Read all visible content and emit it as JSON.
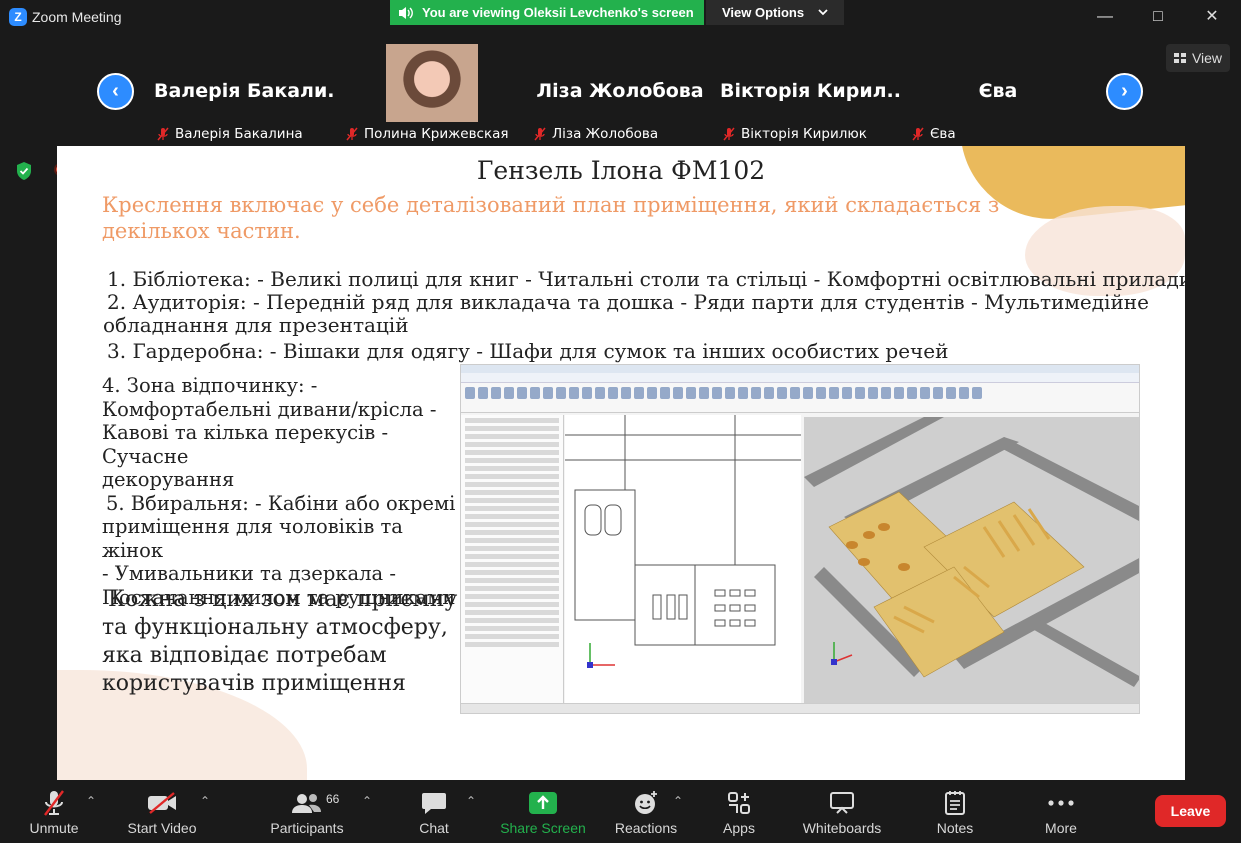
{
  "window": {
    "title": "Zoom Meeting",
    "viewing_banner": "You are viewing Oleksii Levchenko's screen",
    "view_options_label": "View Options",
    "view_label": "View"
  },
  "gallery": {
    "tiles": [
      {
        "big_name": "Валерія Бакали...",
        "sub_name": "Валерія Бакалина"
      },
      {
        "big_name": "",
        "sub_name": "Полина Крижевская"
      },
      {
        "big_name": "Ліза Жолобова",
        "sub_name": "Ліза Жолобова"
      },
      {
        "big_name": "Вікторія Кирил...",
        "sub_name": "Вікторія Кирилюк"
      },
      {
        "big_name": "Єва",
        "sub_name": "Єва"
      }
    ]
  },
  "slide": {
    "title": "Гензель Ілона ФМ102",
    "subtitle": "Креслення включає у себе деталізований план приміщення, який складається з декількох частин.",
    "items": [
      "1. Бібліотека: - Великі полиці для книг - Читальні столи та стільці - Комфортні освітлювальні прилади",
      "2. Аудиторія: - Передній ряд для викладача та дошка - Ряди парти для студентів - Мультимедійне",
      "обладнання для презентацій",
      "3. Гардеробна: - Вішаки для одягу - Шафи для сумок та інших особистих речей"
    ],
    "left_col": [
      "4. Зона відпочинку: -",
      "Комфортабельні дивани/крісла -",
      "Кавові та кілька перекусів - Сучасне",
      "декорування",
      "5. Вбиральня: - Кабіни або окремі",
      "приміщення для чоловіків та жінок",
      "- Умивальники та дзеркала -",
      "Постачання милом та рушниками"
    ],
    "closing": [
      "Кожна з цих зон має приємну",
      "та функціональну атмосферу,",
      "яка відповідає потребам",
      "користувачів приміщення"
    ]
  },
  "toolbar": {
    "unmute": "Unmute",
    "start_video": "Start Video",
    "participants": "Participants",
    "participants_count": "66",
    "chat": "Chat",
    "share_screen": "Share Screen",
    "reactions": "Reactions",
    "apps": "Apps",
    "whiteboards": "Whiteboards",
    "notes": "Notes",
    "more": "More",
    "leave": "Leave"
  },
  "colors": {
    "accent_blue": "#2d8cff",
    "banner_green": "#23b14d",
    "leave_red": "#e02828",
    "subtitle_orange": "#ef9a66"
  }
}
